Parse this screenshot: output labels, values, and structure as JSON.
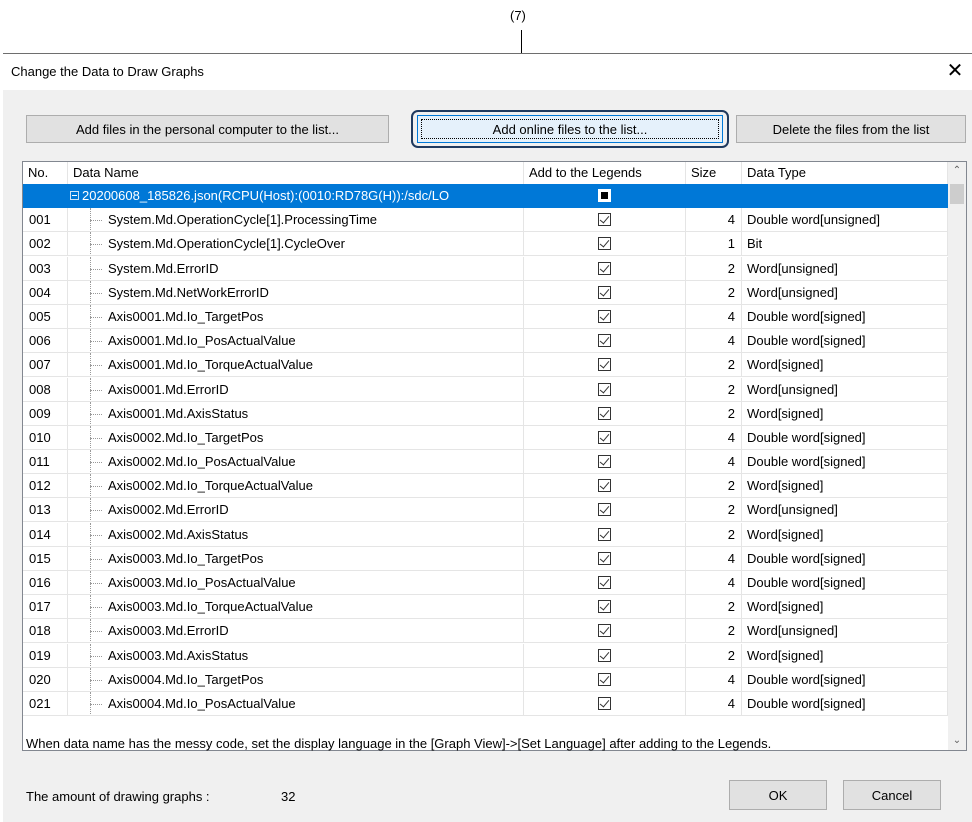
{
  "callout": {
    "label": "(7)"
  },
  "dialog": {
    "title": "Change the Data to Draw Graphs",
    "buttons": {
      "add_pc": "Add files in the personal computer to the list...",
      "add_online": "Add online files to the list...",
      "delete": "Delete the files from the list"
    },
    "table": {
      "columns": [
        "No.",
        "Data Name",
        "Add to the Legends",
        "Size",
        "Data Type"
      ],
      "root": {
        "name": "20200608_185826.json(RCPU(Host):(0010:RD78G(H)):/sdc/LO",
        "legend_state": "indeterminate"
      },
      "rows": [
        {
          "no": "001",
          "name": "System.Md.OperationCycle[1].ProcessingTime",
          "checked": true,
          "size": "4",
          "type": "Double word[unsigned]"
        },
        {
          "no": "002",
          "name": "System.Md.OperationCycle[1].CycleOver",
          "checked": true,
          "size": "1",
          "type": "Bit"
        },
        {
          "no": "003",
          "name": "System.Md.ErrorID",
          "checked": true,
          "size": "2",
          "type": "Word[unsigned]"
        },
        {
          "no": "004",
          "name": "System.Md.NetWorkErrorID",
          "checked": true,
          "size": "2",
          "type": "Word[unsigned]"
        },
        {
          "no": "005",
          "name": "Axis0001.Md.Io_TargetPos",
          "checked": true,
          "size": "4",
          "type": "Double word[signed]"
        },
        {
          "no": "006",
          "name": "Axis0001.Md.Io_PosActualValue",
          "checked": true,
          "size": "4",
          "type": "Double word[signed]"
        },
        {
          "no": "007",
          "name": "Axis0001.Md.Io_TorqueActualValue",
          "checked": true,
          "size": "2",
          "type": "Word[signed]"
        },
        {
          "no": "008",
          "name": "Axis0001.Md.ErrorID",
          "checked": true,
          "size": "2",
          "type": "Word[unsigned]"
        },
        {
          "no": "009",
          "name": "Axis0001.Md.AxisStatus",
          "checked": true,
          "size": "2",
          "type": "Word[signed]"
        },
        {
          "no": "010",
          "name": "Axis0002.Md.Io_TargetPos",
          "checked": true,
          "size": "4",
          "type": "Double word[signed]"
        },
        {
          "no": "011",
          "name": "Axis0002.Md.Io_PosActualValue",
          "checked": true,
          "size": "4",
          "type": "Double word[signed]"
        },
        {
          "no": "012",
          "name": "Axis0002.Md.Io_TorqueActualValue",
          "checked": true,
          "size": "2",
          "type": "Word[signed]"
        },
        {
          "no": "013",
          "name": "Axis0002.Md.ErrorID",
          "checked": true,
          "size": "2",
          "type": "Word[unsigned]"
        },
        {
          "no": "014",
          "name": "Axis0002.Md.AxisStatus",
          "checked": true,
          "size": "2",
          "type": "Word[signed]"
        },
        {
          "no": "015",
          "name": "Axis0003.Md.Io_TargetPos",
          "checked": true,
          "size": "4",
          "type": "Double word[signed]"
        },
        {
          "no": "016",
          "name": "Axis0003.Md.Io_PosActualValue",
          "checked": true,
          "size": "4",
          "type": "Double word[signed]"
        },
        {
          "no": "017",
          "name": "Axis0003.Md.Io_TorqueActualValue",
          "checked": true,
          "size": "2",
          "type": "Word[signed]"
        },
        {
          "no": "018",
          "name": "Axis0003.Md.ErrorID",
          "checked": true,
          "size": "2",
          "type": "Word[unsigned]"
        },
        {
          "no": "019",
          "name": "Axis0003.Md.AxisStatus",
          "checked": true,
          "size": "2",
          "type": "Word[signed]"
        },
        {
          "no": "020",
          "name": "Axis0004.Md.Io_TargetPos",
          "checked": true,
          "size": "4",
          "type": "Double word[signed]"
        },
        {
          "no": "021",
          "name": "Axis0004.Md.Io_PosActualValue",
          "checked": true,
          "size": "4",
          "type": "Double word[signed]"
        }
      ]
    },
    "note": "When data name has the messy code, set the display language in the [Graph View]->[Set Language] after adding to the Legends.",
    "count_label": "The amount of drawing graphs :",
    "count_value": "32",
    "ok": "OK",
    "cancel": "Cancel"
  }
}
